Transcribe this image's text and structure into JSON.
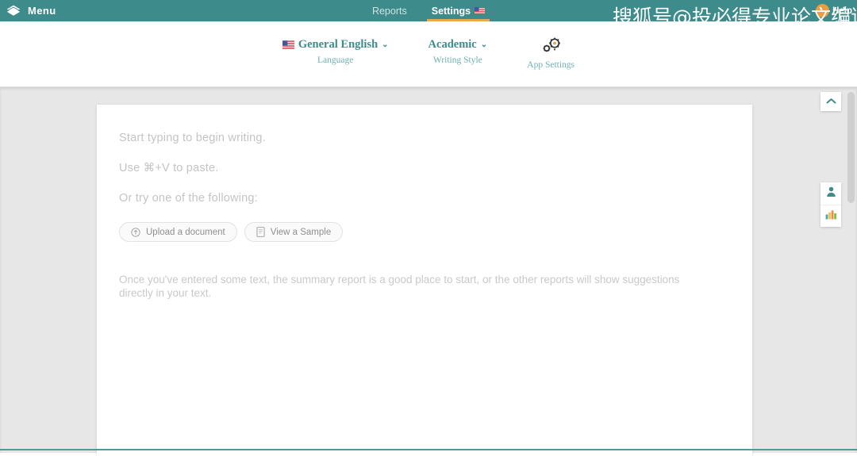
{
  "topbar": {
    "logo_icon": "layers-logo-icon",
    "menu_label": "Menu",
    "nav": [
      {
        "label": "Reports",
        "active": false,
        "icon": null
      },
      {
        "label": "Settings",
        "active": true,
        "icon": "us-flag-icon"
      }
    ],
    "help_label": "Help",
    "help_badge_icon": "help-badge-icon",
    "accent_underline_color": "#e8a84f",
    "background_color": "#3d8b8b"
  },
  "watermark": {
    "text": "搜狐号@投必得专业论文编译"
  },
  "subnav": {
    "items": [
      {
        "title": "General English",
        "subtitle": "Language",
        "icon": "us-flag-icon",
        "caret": "⌄"
      },
      {
        "title": "Academic",
        "subtitle": "Writing Style",
        "icon": null,
        "caret": "⌄"
      },
      {
        "title": "",
        "subtitle": "App Settings",
        "icon": "gear-icon",
        "caret": ""
      }
    ],
    "title_color": "#3d8b8b",
    "subtitle_color": "#6fb0b0"
  },
  "editor": {
    "lines": [
      "Start typing to begin writing.",
      "Use ⌘+V to paste.",
      "Or try one of the following:"
    ],
    "buttons": [
      {
        "label": "Upload a document",
        "icon": "upload-circle-icon"
      },
      {
        "label": "View a Sample",
        "icon": "document-icon"
      }
    ],
    "paragraph": "Once you've entered some text, the summary report is a good place to start, or the other reports will show suggestions directly in your text."
  },
  "rail": {
    "collapse_icon": "chevron-up-icon",
    "buttons": [
      {
        "icon": "person-icon"
      },
      {
        "icon": "bar-chart-icon"
      }
    ],
    "chart_colors": [
      "#4aa8a8",
      "#f0c24a",
      "#f08a4a",
      "#7fc241"
    ]
  }
}
